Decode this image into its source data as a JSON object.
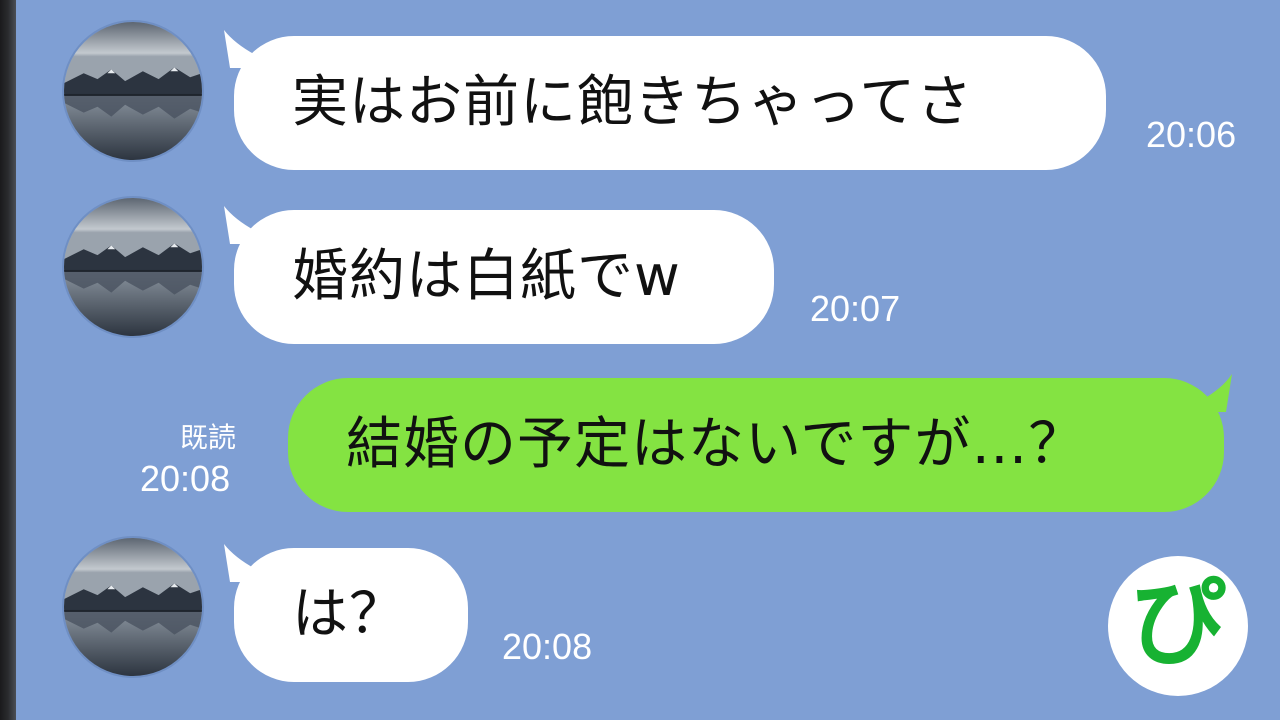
{
  "messages": [
    {
      "text": "実はお前に飽きちゃってさ",
      "time": "20:06"
    },
    {
      "text": "婚約は白紙でw",
      "time": "20:07"
    },
    {
      "text": "結婚の予定はないですが…？",
      "time": "20:08",
      "read_label": "既読"
    },
    {
      "text": "は？",
      "time": "20:08"
    }
  ],
  "logo": {
    "text": "ぴ",
    "color": "#17b232"
  },
  "colors": {
    "background": "#7f9fd4",
    "incoming_bubble": "#ffffff",
    "outgoing_bubble": "#84e342"
  }
}
